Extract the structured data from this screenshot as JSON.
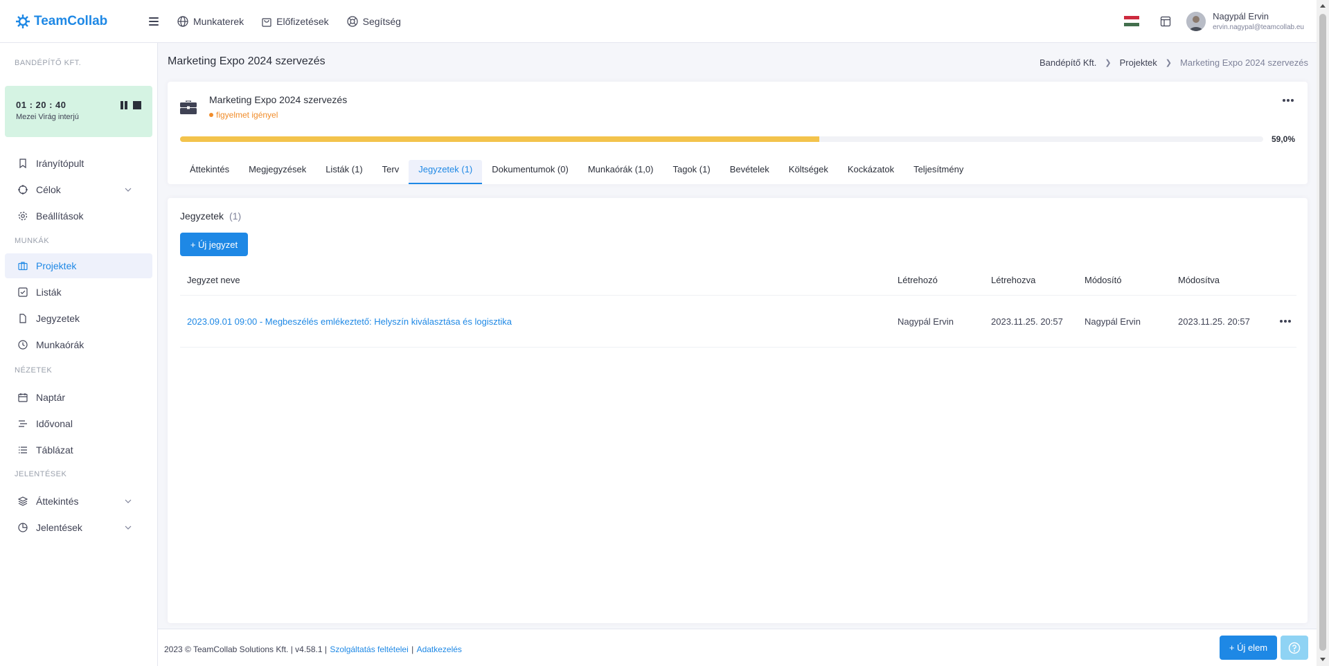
{
  "app": {
    "name": "TeamCollab"
  },
  "topnav": [
    {
      "label": "Munkaterek",
      "icon": "globe-icon"
    },
    {
      "label": "Előfizetések",
      "icon": "shopping-bag-icon"
    },
    {
      "label": "Segítség",
      "icon": "lifebuoy-icon"
    }
  ],
  "user": {
    "name": "Nagypál Ervin",
    "email": "ervin.nagypal@teamcollab.eu"
  },
  "colors": {
    "accent": "#1e88e5",
    "warning": "#f08c2a",
    "progress": "#f3c34c",
    "timer_bg": "#d5f3e3"
  },
  "sidebar": {
    "org": "BANDÉPÍTŐ KFT.",
    "timer": {
      "time": "01 : 20 : 40",
      "label": "Mezei Virág interjú"
    },
    "items": [
      {
        "label": "Irányítópult",
        "icon": "bookmark-icon"
      },
      {
        "label": "Célok",
        "icon": "target-icon"
      },
      {
        "label": "Beállítások",
        "icon": "gear-icon"
      },
      {
        "label": "Projektek",
        "icon": "briefcase-icon"
      },
      {
        "label": "Listák",
        "icon": "checkbox-icon"
      },
      {
        "label": "Jegyzetek",
        "icon": "file-icon"
      },
      {
        "label": "Munkaórák",
        "icon": "clock-icon"
      },
      {
        "label": "Naptár",
        "icon": "calendar-icon"
      },
      {
        "label": "Idővonal",
        "icon": "timeline-icon"
      },
      {
        "label": "Táblázat",
        "icon": "list-icon"
      },
      {
        "label": "Áttekintés",
        "icon": "layers-icon"
      },
      {
        "label": "Jelentések",
        "icon": "pie-chart-icon"
      }
    ],
    "sections": [
      "MUNKÁK",
      "NÉZETEK",
      "JELENTÉSEK"
    ]
  },
  "page": {
    "title": "Marketing Expo 2024 szervezés",
    "breadcrumb": [
      "Bandépítő Kft.",
      "Projektek",
      "Marketing Expo 2024 szervezés"
    ]
  },
  "project": {
    "name": "Marketing Expo 2024 szervezés",
    "status": "figyelmet igényel",
    "progress": 0.59,
    "progress_label": "59,0%"
  },
  "tabs": [
    "Áttekintés",
    "Megjegyzések",
    "Listák (1)",
    "Terv",
    "Jegyzetek (1)",
    "Dokumentumok (0)",
    "Munkaórák (1,0)",
    "Tagok (1)",
    "Bevételek",
    "Költségek",
    "Kockázatok",
    "Teljesítmény"
  ],
  "notes": {
    "title": "Jegyzetek",
    "count": "(1)",
    "new_button": "+ Új jegyzet",
    "columns": [
      "Jegyzet neve",
      "Létrehozó",
      "Létrehozva",
      "Módosító",
      "Módosítva"
    ],
    "rows": [
      {
        "name": "2023.09.01 09:00 - Megbeszélés emlékeztető: Helyszín kiválasztása és logisztika",
        "creator": "Nagypál Ervin",
        "created": "2023.11.25. 20:57",
        "modifier": "Nagypál Ervin",
        "modified": "2023.11.25. 20:57"
      }
    ]
  },
  "footer": {
    "copyright": "2023 © TeamCollab Solutions Kft. | v4.58.1 |",
    "terms": "Szolgáltatás feltételei",
    "sep": "|",
    "privacy": "Adatkezelés",
    "new_item": "+ Új elem"
  }
}
